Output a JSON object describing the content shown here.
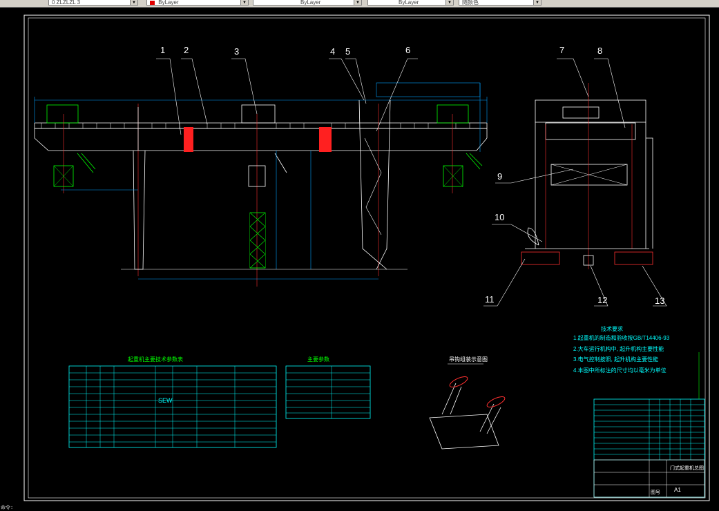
{
  "toolbar": {
    "layer_combo": "0 ZLZLZL 3",
    "color_combo": "ByLayer",
    "linetype_combo": "ByLayer",
    "lineweight_combo": "ByLayer",
    "plotstyle_combo": "随颜色"
  },
  "drawing": {
    "callouts": [
      "1",
      "2",
      "3",
      "4",
      "5",
      "6",
      "7",
      "8",
      "9",
      "10",
      "11",
      "12",
      "13"
    ],
    "table1_title": "起重机主要技术参数表",
    "table2_title": "主要参数",
    "detail_title": "吊钩组装示意图",
    "sew_label": "SEW",
    "tech_req_title": "技术要求",
    "tech_req_items": [
      "1.起重机的制造和验收按GB/T14406-93",
      "2.大车运行机构中,  起升机构主要性能",
      "3.电气控制按照, 起升机构主要性能",
      "4.本图中所标注的尺寸均以毫米为单位"
    ],
    "tech_req_standard": "GB/T14406-93",
    "title_block_label": "图号",
    "title_block_name": "门式起重机总图",
    "title_block_code": "A1"
  },
  "status_bar": {
    "text": "命令:"
  }
}
